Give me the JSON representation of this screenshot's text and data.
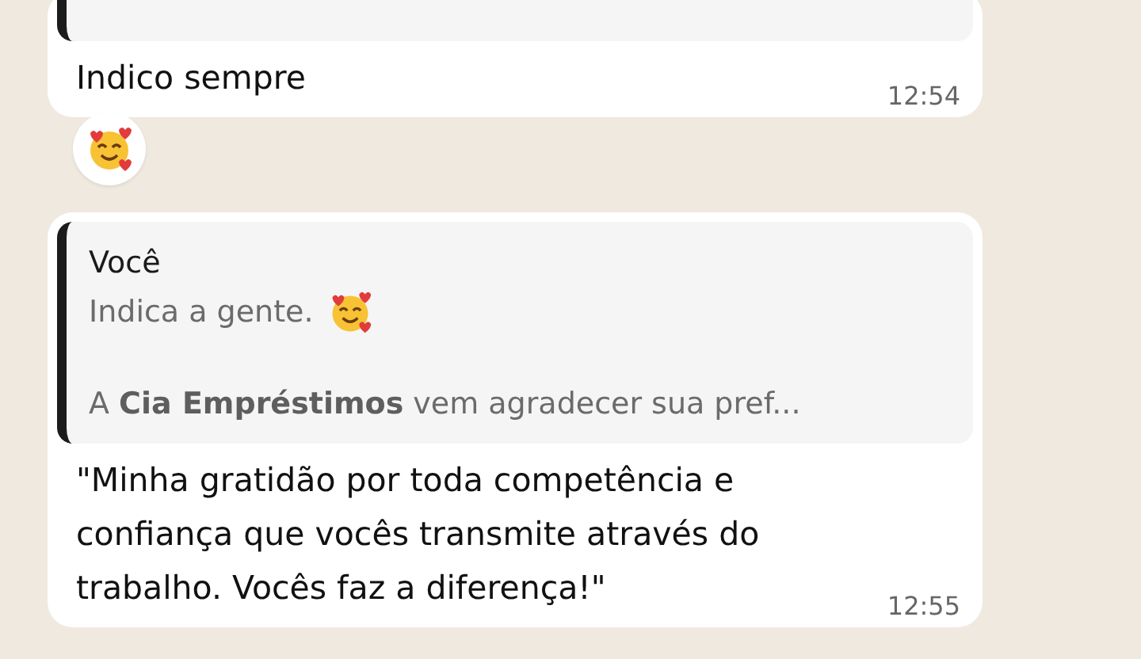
{
  "messages": [
    {
      "quote": {
        "kind": "cut"
      },
      "text": "Indico sempre",
      "time": "12:54",
      "reaction": true
    },
    {
      "quote": {
        "kind": "full",
        "author": "Você",
        "text": "Indica a gente.",
        "trailing_emoji": true,
        "preview": "A **Cia Empréstimos** vem agradecer sua pref..."
      },
      "text": "\"Minha gratidão por toda competência e confiança que vocês transmite através do trabalho. Vocês faz a diferença!\"",
      "time": "12:55",
      "reaction": false
    }
  ]
}
